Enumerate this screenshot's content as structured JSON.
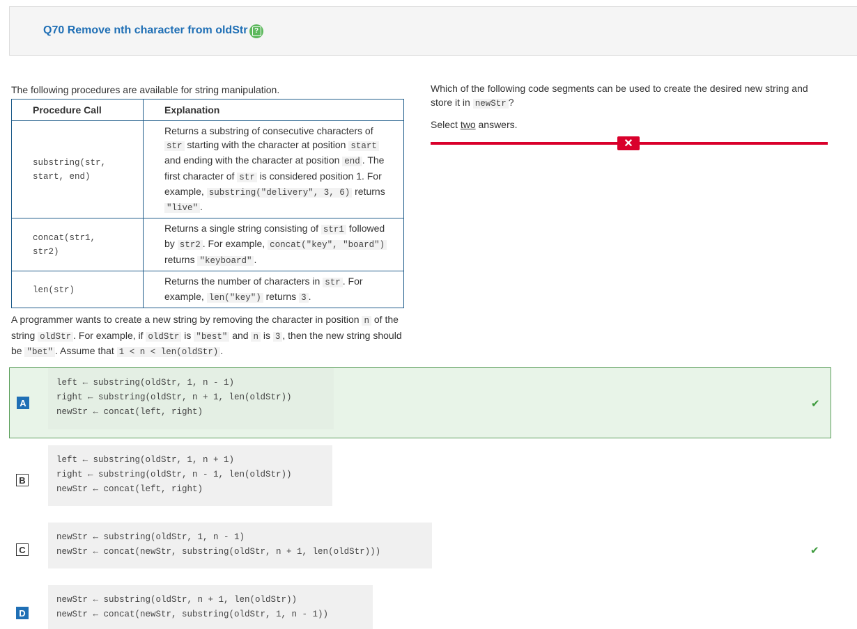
{
  "question": {
    "title": "Q70 Remove nth character from oldStr",
    "intro": "The following procedures are available for string manipulation."
  },
  "table": {
    "headers": [
      "Procedure Call",
      "Explanation"
    ],
    "rows": [
      {
        "call": "substring(str, start, end)",
        "explanation": [
          {
            "t": "Returns a substring of consecutive characters of "
          },
          {
            "c": "str"
          },
          {
            "t": " starting with the character at position "
          },
          {
            "c": "start"
          },
          {
            "t": " and ending with the character at position "
          },
          {
            "c": "end"
          },
          {
            "t": ". The first character of "
          },
          {
            "c": "str"
          },
          {
            "t": " is considered position 1. For example, "
          },
          {
            "c": "substring(\"delivery\", 3, 6)"
          },
          {
            "t": " returns "
          },
          {
            "c": "\"live\""
          },
          {
            "t": "."
          }
        ]
      },
      {
        "call": "concat(str1, str2)",
        "explanation": [
          {
            "t": "Returns a single string consisting of "
          },
          {
            "c": "str1"
          },
          {
            "t": " followed by "
          },
          {
            "c": "str2"
          },
          {
            "t": ". For example, "
          },
          {
            "c": "concat(\"key\", \"board\")"
          },
          {
            "t": " returns "
          },
          {
            "c": "\"keyboard\""
          },
          {
            "t": "."
          }
        ]
      },
      {
        "call": "len(str)",
        "explanation": [
          {
            "t": "Returns the number of characters in "
          },
          {
            "c": "str"
          },
          {
            "t": ".  For example, "
          },
          {
            "c": "len(\"key\")"
          },
          {
            "t": " returns "
          },
          {
            "c": "3"
          },
          {
            "t": "."
          }
        ]
      }
    ]
  },
  "description": [
    {
      "t": "A programmer wants to create a new string by removing the character in position "
    },
    {
      "c": "n"
    },
    {
      "t": " of the string "
    },
    {
      "c": "oldStr"
    },
    {
      "t": ". For example, if "
    },
    {
      "c": "oldStr"
    },
    {
      "t": " is "
    },
    {
      "c": "\"best\""
    },
    {
      "t": " and "
    },
    {
      "c": "n"
    },
    {
      "t": " is "
    },
    {
      "c": "3"
    },
    {
      "t": ", then the new string should be "
    },
    {
      "c": "\"bet\""
    },
    {
      "t": ".  Assume that "
    },
    {
      "c": "1 < n < len(oldStr)"
    },
    {
      "t": "."
    }
  ],
  "prompt": [
    {
      "t": "Which of the following code segments can be used to create the desired new string and store it in "
    },
    {
      "c": "newStr"
    },
    {
      "t": "?"
    }
  ],
  "select": {
    "pre": "Select ",
    "u": "two",
    "post": " answers."
  },
  "options": [
    {
      "letter": "A",
      "code": "left ← substring(oldStr, 1, n - 1)\nright ← substring(oldStr, n + 1, len(oldStr))\nnewStr ← concat(left, right)",
      "selected": true,
      "correct": true
    },
    {
      "letter": "B",
      "code": "left ← substring(oldStr, 1, n + 1)\nright ← substring(oldStr, n - 1, len(oldStr))\nnewStr ← concat(left, right)",
      "selected": false,
      "correct": false
    },
    {
      "letter": "C",
      "code": "newStr ← substring(oldStr, 1, n - 1)\nnewStr ← concat(newStr, substring(oldStr, n + 1, len(oldStr)))",
      "selected": false,
      "correct": true
    },
    {
      "letter": "D",
      "code": "newStr ← substring(oldStr, n + 1, len(oldStr))\nnewStr ← concat(newStr, substring(oldStr, 1, n - 1))",
      "selected": true,
      "correct": false
    }
  ],
  "icons": {
    "help": "help-icon",
    "check": "check-icon",
    "close": "close-icon"
  },
  "colors": {
    "accent": "#1f6fb5",
    "correct": "#3c9a3c",
    "incorrect": "#d9002b",
    "selected_bg": "#e8f4e8"
  }
}
